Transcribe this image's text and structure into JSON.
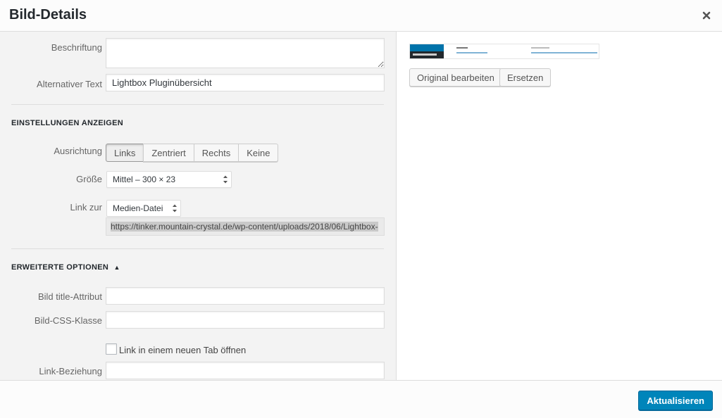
{
  "header": {
    "title": "Bild-Details"
  },
  "form": {
    "caption_label": "Beschriftung",
    "caption_value": "",
    "alt_label": "Alternativer Text",
    "alt_value": "Lightbox Pluginübersicht"
  },
  "display_settings": {
    "heading": "EINSTELLUNGEN ANZEIGEN",
    "align_label": "Ausrichtung",
    "align_options": [
      "Links",
      "Zentriert",
      "Rechts",
      "Keine"
    ],
    "align_selected": "Links",
    "size_label": "Größe",
    "size_value": "Mittel – 300 × 23",
    "link_label": "Link zur",
    "link_value": "Medien-Datei",
    "link_url": "https://tinker.mountain-crystal.de/wp-content/uploads/2018/06/Lightbox-"
  },
  "advanced": {
    "heading": "ERWEITERTE OPTIONEN",
    "toggle_glyph": "▲",
    "title_attr_label": "Bild title-Attribut",
    "title_attr_value": "",
    "css_class_label": "Bild-CSS-Klasse",
    "css_class_value": "",
    "new_tab_label": "Link in einem neuen Tab öffnen",
    "new_tab_checked": false,
    "rel_label": "Link-Beziehung",
    "rel_value": ""
  },
  "preview": {
    "edit_original_label": "Original bearbeiten",
    "replace_label": "Ersetzen"
  },
  "footer": {
    "update_label": "Aktualisieren"
  },
  "colors": {
    "primary": "#0085ba",
    "sidebar_dark": "#23282d",
    "pane_bg": "#f3f3f3"
  }
}
